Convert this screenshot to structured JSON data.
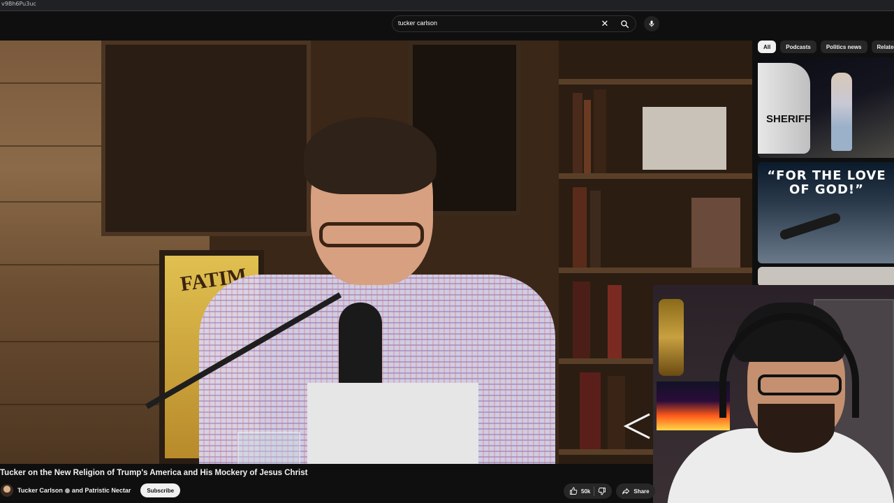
{
  "browser": {
    "url_fragment": "v9Bh6Pu3uc"
  },
  "search": {
    "query": "tucker carlson"
  },
  "chips": [
    "All",
    "Podcasts",
    "Politics news",
    "Related"
  ],
  "recommendations": [
    {
      "thumb_text": "SHERIFF"
    },
    {
      "thumb_text": "“FOR THE LOVE OF GOD!”"
    }
  ],
  "video": {
    "title": "Tucker on the New Religion of Trump's America and His Mockery of Jesus Christ",
    "poster_text": "FATIM",
    "channel": "Tucker Carlson",
    "collab": "and Patristic Nectar",
    "subscribe_label": "Subscribe",
    "likes": "50k",
    "share_label": "Share"
  },
  "colors": {
    "background": "#0f0f0f",
    "chip_active": "#f1f1f1",
    "pill": "#272727"
  }
}
